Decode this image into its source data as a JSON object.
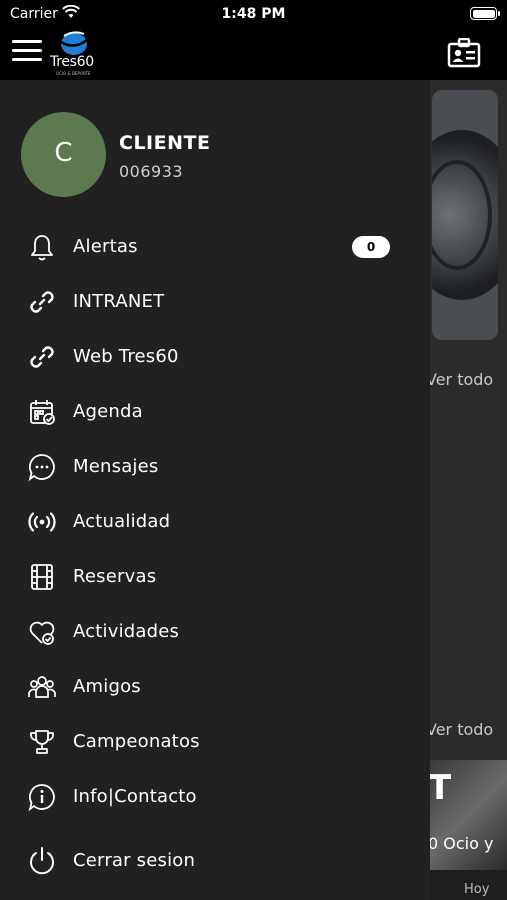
{
  "status_bar": {
    "carrier": "Carrier",
    "time": "1:48 PM"
  },
  "header": {
    "logo_text": "Tres60",
    "logo_subtext": "OCIO & DEPORTE"
  },
  "drawer": {
    "user": {
      "initial": "C",
      "name": "CLIENTE",
      "id": "006933"
    },
    "menu": [
      {
        "label": "Alertas",
        "icon": "bell-icon",
        "badge": "0"
      },
      {
        "label": "INTRANET",
        "icon": "link-icon"
      },
      {
        "label": "Web Tres60",
        "icon": "link-icon"
      },
      {
        "label": "Agenda",
        "icon": "calendar-icon"
      },
      {
        "label": "Mensajes",
        "icon": "chat-icon"
      },
      {
        "label": "Actualidad",
        "icon": "broadcast-icon"
      },
      {
        "label": "Reservas",
        "icon": "film-icon"
      },
      {
        "label": "Actividades",
        "icon": "heart-check-icon"
      },
      {
        "label": "Amigos",
        "icon": "people-icon"
      },
      {
        "label": "Campeonatos",
        "icon": "trophy-icon"
      },
      {
        "label": "Info|Contacto",
        "icon": "info-icon"
      },
      {
        "label": "Cerrar sesion",
        "icon": "power-icon"
      }
    ]
  },
  "background": {
    "section1_link": "Ver todo",
    "section2_link": "Ver todo",
    "card_title": "T",
    "card_subtitle": "0 Ocio y",
    "card_date": "Hoy"
  },
  "colors": {
    "drawer_bg": "#212121",
    "avatar_bg": "#5b7a4f",
    "header_bg": "#000000",
    "logo_blue": "#1f7fd6"
  }
}
